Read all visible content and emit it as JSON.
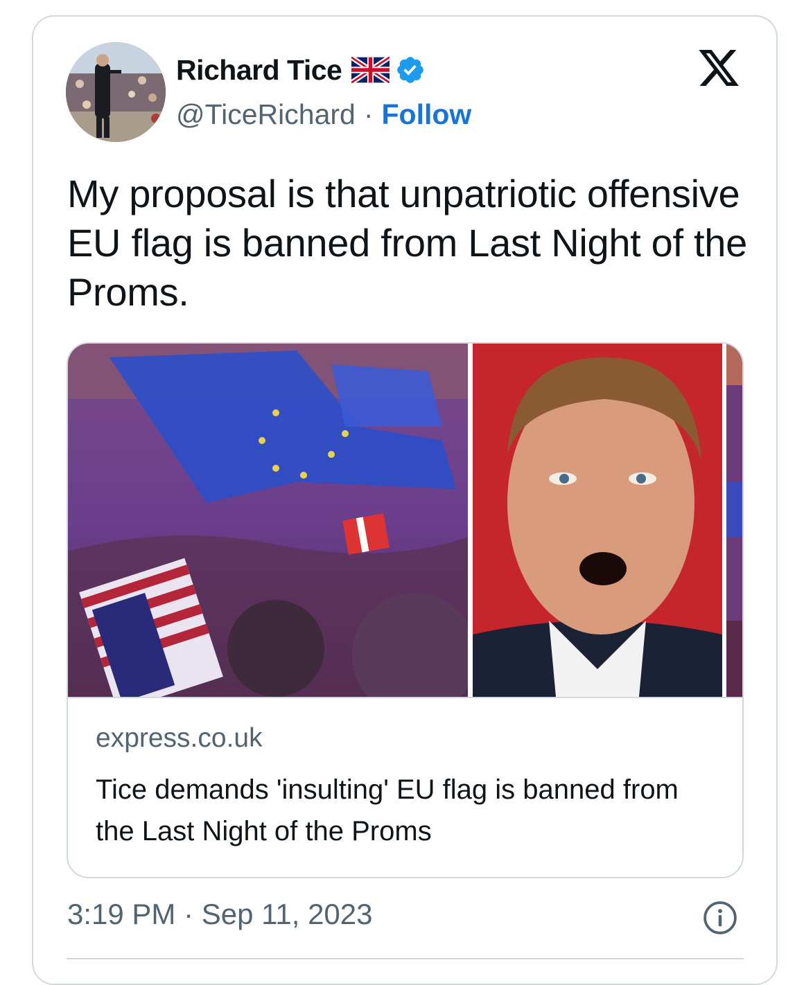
{
  "author": {
    "name": "Richard Tice",
    "handle": "@TiceRichard",
    "separator": "·",
    "follow_label": "Follow",
    "flag_icon": "uk-flag-icon",
    "verified_icon": "verified-badge-icon",
    "verified_color": "#1d9bf0"
  },
  "platform_logo": "x-logo-icon",
  "tweet": {
    "text": "My proposal is that unpatriotic offensive EU flag is banned from Last Night of the Proms."
  },
  "link_card": {
    "domain": "express.co.uk",
    "headline": "Tice demands 'insulting' EU flag is banned from the Last Night of the Proms"
  },
  "meta": {
    "timestamp": "3:19 PM · Sep 11, 2023",
    "info_icon": "info-icon"
  },
  "colors": {
    "text": "#0f1419",
    "secondary": "#536471",
    "border": "#cfd9de",
    "link": "#1a73d6"
  }
}
